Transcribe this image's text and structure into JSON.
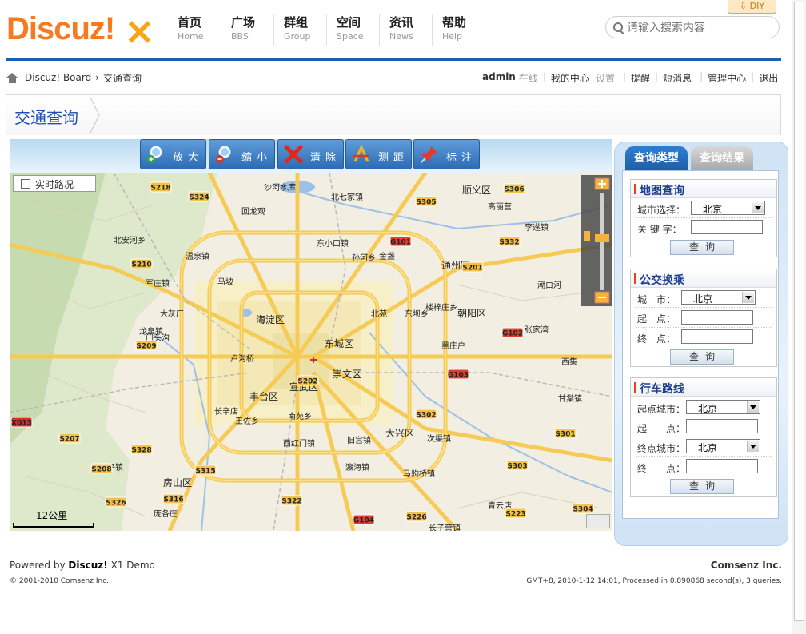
{
  "header": {
    "logo": "Discuz!",
    "diy": "DIY",
    "nav": [
      {
        "zh": "首页",
        "en": "Home"
      },
      {
        "zh": "广场",
        "en": "BBS"
      },
      {
        "zh": "群组",
        "en": "Group"
      },
      {
        "zh": "空间",
        "en": "Space"
      },
      {
        "zh": "资讯",
        "en": "News"
      },
      {
        "zh": "帮助",
        "en": "Help"
      }
    ],
    "search_placeholder": "请输入搜索内容"
  },
  "breadcrumb": {
    "root": "Discuz! Board",
    "sep": "›",
    "current": "交通查询"
  },
  "user": {
    "name": "admin",
    "status": "在线",
    "links": [
      "我的中心",
      "设置",
      "提醒",
      "短消息",
      "管理中心",
      "退出"
    ]
  },
  "page": {
    "title": "交通查询"
  },
  "toolbar": {
    "tools": [
      "放大",
      "缩小",
      "清除",
      "测距",
      "标注"
    ]
  },
  "map": {
    "traffic_label": "实时路况",
    "scale_label": "12公里",
    "labels": [
      "沙河水库",
      "北七家镇",
      "顺义区",
      "东小口镇",
      "孙河乡",
      "李遂镇",
      "海淀区",
      "东城区",
      "崇文区",
      "宣武区",
      "丰台区",
      "朝阳区",
      "门头沟",
      "房山区",
      "大兴区",
      "通州区",
      "马坡",
      "北安河乡",
      "温泉镇",
      "龙泉镇",
      "王平镇",
      "军庄镇",
      "西红门镇",
      "旧宫镇",
      "南苑乡",
      "瀛海镇",
      "次渠镇",
      "马驹桥镇",
      "长子营镇",
      "甘棠镇",
      "张家湾",
      "西集",
      "潮白河",
      "高丽营",
      "回龙观",
      "北苑",
      "金盏",
      "楼梓庄乡",
      "黑庄户",
      "东坝乡",
      "长辛店",
      "王佐乡",
      "大灰厂",
      "卢沟桥",
      "青云店",
      "庞各庄"
    ],
    "shields": [
      "S218",
      "S324",
      "S305",
      "S306",
      "S332",
      "G101",
      "S201",
      "S210",
      "S209",
      "G102",
      "G103",
      "S302",
      "S301",
      "X013",
      "S207",
      "S328",
      "S208",
      "S315",
      "S316",
      "S326",
      "S322",
      "S303",
      "S304",
      "S223",
      "G104",
      "S226",
      "S202"
    ]
  },
  "panel": {
    "tabs": [
      "查询类型",
      "查询结果"
    ],
    "map_search": {
      "title": "地图查询",
      "city_label": "城市选择：",
      "city_value": "北京",
      "keyword_label": "关 键 字：",
      "button": "查询"
    },
    "bus": {
      "title": "公交换乘",
      "city_label": "城　市：",
      "city_value": "北京",
      "from_label": "起　点：",
      "to_label": "终　点：",
      "button": "查询"
    },
    "drive": {
      "title": "行车路线",
      "from_city_label": "起点城市：",
      "from_city_value": "北京",
      "from_label": "起　　点：",
      "to_city_label": "终点城市：",
      "to_city_value": "北京",
      "to_label": "终　　点：",
      "button": "查询"
    }
  },
  "footer": {
    "powered_prefix": "Powered by",
    "product": "Discuz!",
    "version": "X1 Demo",
    "copyright": "© 2001-2010 Comsenz Inc.",
    "company": "Comsenz Inc.",
    "stats": "GMT+8, 2010-1-12 14:01, Processed in 0.890868 second(s), 3 queries."
  },
  "colors": {
    "brand_orange": "#f47b20",
    "nav_blue": "#1c5fb0",
    "tab_blue": "#2d7ed0",
    "title_blue": "#1f4bb3"
  }
}
